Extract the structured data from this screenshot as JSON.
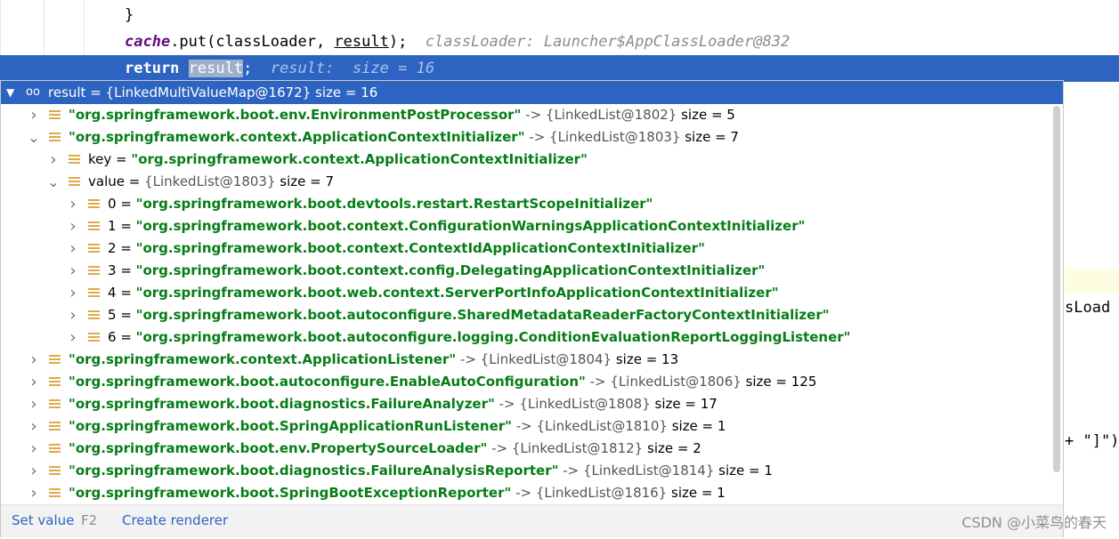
{
  "editor": {
    "line1": "}",
    "line2_call": "cache",
    "line2_rest": ".put(classLoader, ",
    "line2_arg": "result",
    "line2_end": ");",
    "line2_hint": "classLoader: Launcher$AppClassLoader@832",
    "line3_kw": "return",
    "line3_var": "result",
    "line3_end": ";",
    "line3_hint": "result:  size = 16",
    "right_frag1": "sLoad",
    "right_frag2": "+ \"]\")"
  },
  "popup": {
    "header": "result = {LinkedMultiValueMap@1672}  size = 16",
    "rows": [
      {
        "key": "\"org.springframework.boot.env.EnvironmentPostProcessor\"",
        "value": " -> {LinkedList@1802}",
        "size": "  size = 5"
      },
      {
        "key": "\"org.springframework.context.ApplicationContextInitializer\"",
        "value": " -> {LinkedList@1803}",
        "size": "  size = 7"
      },
      {
        "label": "key",
        "eq": " = ",
        "key": "\"org.springframework.context.ApplicationContextInitializer\""
      },
      {
        "label": "value",
        "eq": " = ",
        "value": "{LinkedList@1803}",
        "size": "  size = 7"
      },
      {
        "label": "0",
        "eq": " = ",
        "key": "\"org.springframework.boot.devtools.restart.RestartScopeInitializer\""
      },
      {
        "label": "1",
        "eq": " = ",
        "key": "\"org.springframework.boot.context.ConfigurationWarningsApplicationContextInitializer\""
      },
      {
        "label": "2",
        "eq": " = ",
        "key": "\"org.springframework.boot.context.ContextIdApplicationContextInitializer\""
      },
      {
        "label": "3",
        "eq": " = ",
        "key": "\"org.springframework.boot.context.config.DelegatingApplicationContextInitializer\""
      },
      {
        "label": "4",
        "eq": " = ",
        "key": "\"org.springframework.boot.web.context.ServerPortInfoApplicationContextInitializer\""
      },
      {
        "label": "5",
        "eq": " = ",
        "key": "\"org.springframework.boot.autoconfigure.SharedMetadataReaderFactoryContextInitializer\""
      },
      {
        "label": "6",
        "eq": " = ",
        "key": "\"org.springframework.boot.autoconfigure.logging.ConditionEvaluationReportLoggingListener\""
      },
      {
        "key": "\"org.springframework.context.ApplicationListener\"",
        "value": " -> {LinkedList@1804}",
        "size": "  size = 13"
      },
      {
        "key": "\"org.springframework.boot.autoconfigure.EnableAutoConfiguration\"",
        "value": " -> {LinkedList@1806}",
        "size": "  size = 125"
      },
      {
        "key": "\"org.springframework.boot.diagnostics.FailureAnalyzer\"",
        "value": " -> {LinkedList@1808}",
        "size": "  size = 17"
      },
      {
        "key": "\"org.springframework.boot.SpringApplicationRunListener\"",
        "value": " -> {LinkedList@1810}",
        "size": "  size = 1"
      },
      {
        "key": "\"org.springframework.boot.env.PropertySourceLoader\"",
        "value": " -> {LinkedList@1812}",
        "size": "  size = 2"
      },
      {
        "key": "\"org.springframework.boot.diagnostics.FailureAnalysisReporter\"",
        "value": " -> {LinkedList@1814}",
        "size": "  size = 1"
      },
      {
        "key": "\"org.springframework.boot.SpringBootExceptionReporter\"",
        "value": " -> {LinkedList@1816}",
        "size": "  size = 1"
      }
    ],
    "footer": {
      "set_value": "Set value",
      "set_value_key": "F2",
      "create_renderer": "Create renderer"
    }
  },
  "watermark": "CSDN @小菜鸟的春天",
  "colors": {
    "accent": "#2e64c1",
    "string": "#067d17",
    "field_icon": "#e0a94a"
  },
  "icons": [
    "chevron-right-icon",
    "chevron-down-icon",
    "field-icon",
    "glasses-icon"
  ]
}
